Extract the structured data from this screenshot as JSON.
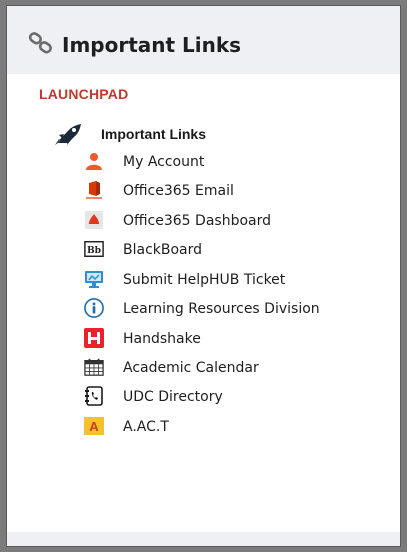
{
  "header": {
    "title": "Important Links",
    "icon": "link-chain-icon"
  },
  "launchpad": {
    "label": "LAUNCHPAD",
    "color": "#c0392b"
  },
  "group": {
    "label": "Important Links",
    "icon": "rocket-icon"
  },
  "links": [
    {
      "label": "My Account",
      "icon": "user-icon"
    },
    {
      "label": "Office365 Email",
      "icon": "office365-icon"
    },
    {
      "label": "Office365 Dashboard",
      "icon": "office365-dashboard-icon"
    },
    {
      "label": "BlackBoard",
      "icon": "blackboard-icon"
    },
    {
      "label": "Submit HelpHUB Ticket",
      "icon": "monitor-icon"
    },
    {
      "label": "Learning Resources Division",
      "icon": "info-icon"
    },
    {
      "label": "Handshake",
      "icon": "handshake-icon"
    },
    {
      "label": "Academic Calendar",
      "icon": "calendar-icon"
    },
    {
      "label": "UDC Directory",
      "icon": "phone-book-icon"
    },
    {
      "label": "A.AC.T",
      "icon": "aact-icon"
    }
  ]
}
